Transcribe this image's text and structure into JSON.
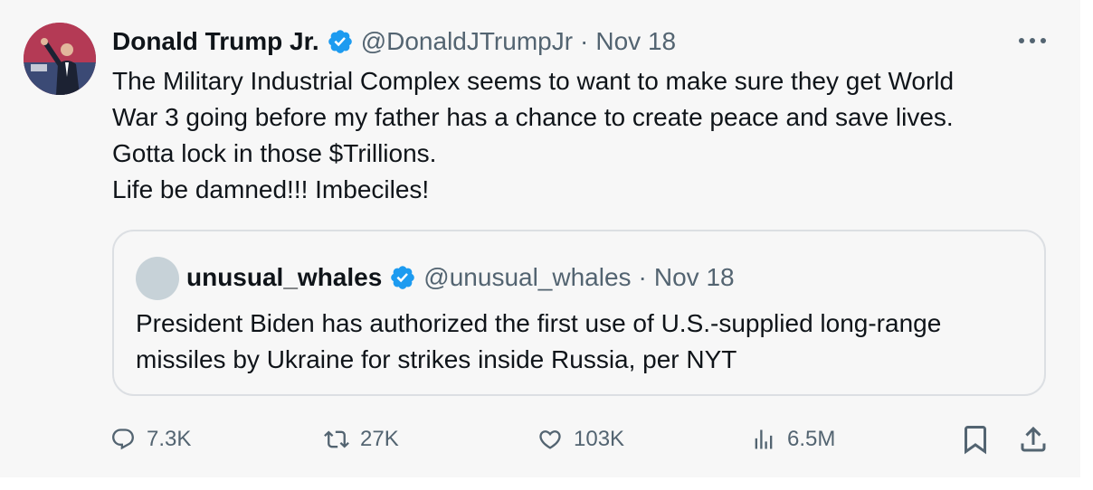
{
  "tweet": {
    "author_name": "Donald Trump Jr.",
    "handle": "@DonaldJTrumpJr",
    "separator": "·",
    "date": "Nov 18",
    "text_lines": [
      "The Military Industrial Complex seems to want to make sure they get World",
      "War 3 going before my father has a chance to create peace and save lives.",
      "Gotta lock in those $Trillions.",
      "Life be damned!!! Imbeciles!"
    ]
  },
  "quote": {
    "author_name": "unusual_whales",
    "handle": "@unusual_whales",
    "separator": "·",
    "date": "Nov 18",
    "text_lines": [
      "President Biden has authorized the first use of U.S.-supplied long-range",
      "missiles by Ukraine for strikes inside Russia, per NYT"
    ]
  },
  "actions": {
    "replies": "7.3K",
    "reposts": "27K",
    "likes": "103K",
    "views": "6.5M"
  },
  "icons": {
    "verified": "verified-badge-icon",
    "more": "more-icon",
    "reply": "reply-icon",
    "repost": "repost-icon",
    "like": "heart-icon",
    "views": "views-icon",
    "bookmark": "bookmark-icon",
    "share": "share-icon"
  },
  "colors": {
    "background": "#f7f7f7",
    "text": "#0f1419",
    "secondary_text": "#536471",
    "verified_blue": "#1d9bf0",
    "quote_border": "#dcdfe3"
  }
}
